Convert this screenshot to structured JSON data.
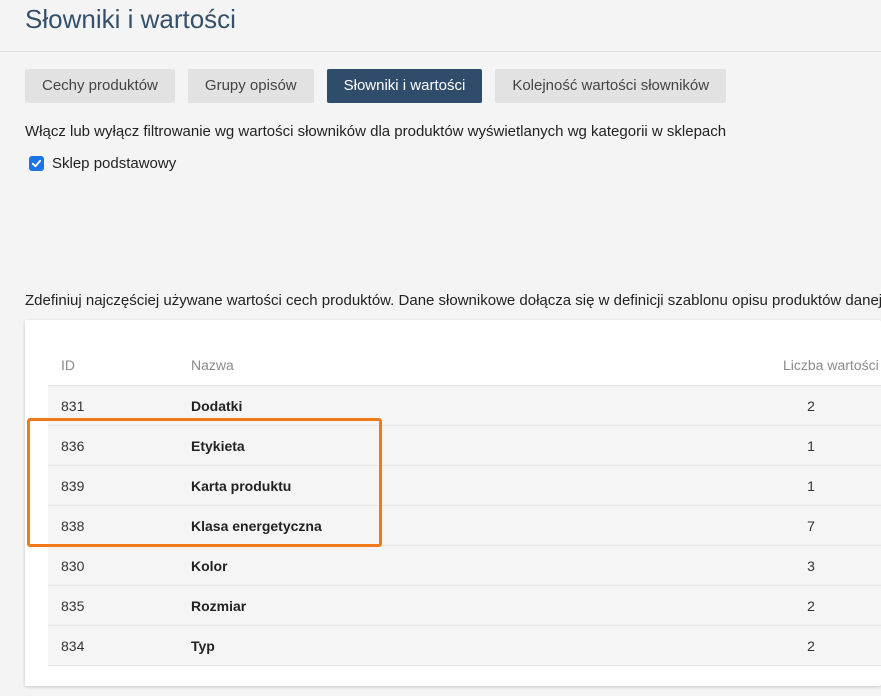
{
  "header": {
    "title": "Słowniki i wartości"
  },
  "tabs": [
    {
      "label": "Cechy produktów",
      "active": false
    },
    {
      "label": "Grupy opisów",
      "active": false
    },
    {
      "label": "Słowniki i wartości",
      "active": true
    },
    {
      "label": "Kolejność wartości słowników",
      "active": false
    }
  ],
  "filter": {
    "description": "Włącz lub wyłącz filtrowanie wg wartości słowników dla produktów wyświetlanych wg kategorii w sklepach",
    "checkbox_label": "Sklep podstawowy",
    "checked": true
  },
  "dictionaries": {
    "description": "Zdefiniuj najczęściej używane wartości cech produktów. Dane słownikowe dołącza się w definicji szablonu opisu produktów danej",
    "columns": {
      "id": "ID",
      "name": "Nazwa",
      "count": "Liczba wartości"
    },
    "rows": [
      {
        "id": "831",
        "name": "Dodatki",
        "count": "2"
      },
      {
        "id": "836",
        "name": "Etykieta",
        "count": "1"
      },
      {
        "id": "839",
        "name": "Karta produktu",
        "count": "1"
      },
      {
        "id": "838",
        "name": "Klasa energetyczna",
        "count": "7"
      },
      {
        "id": "830",
        "name": "Kolor",
        "count": "3"
      },
      {
        "id": "835",
        "name": "Rozmiar",
        "count": "2"
      },
      {
        "id": "834",
        "name": "Typ",
        "count": "2"
      }
    ]
  },
  "colors": {
    "accent_tab": "#2f4d6b",
    "highlight": "#f07a1a",
    "checkbox": "#1a73e8"
  }
}
